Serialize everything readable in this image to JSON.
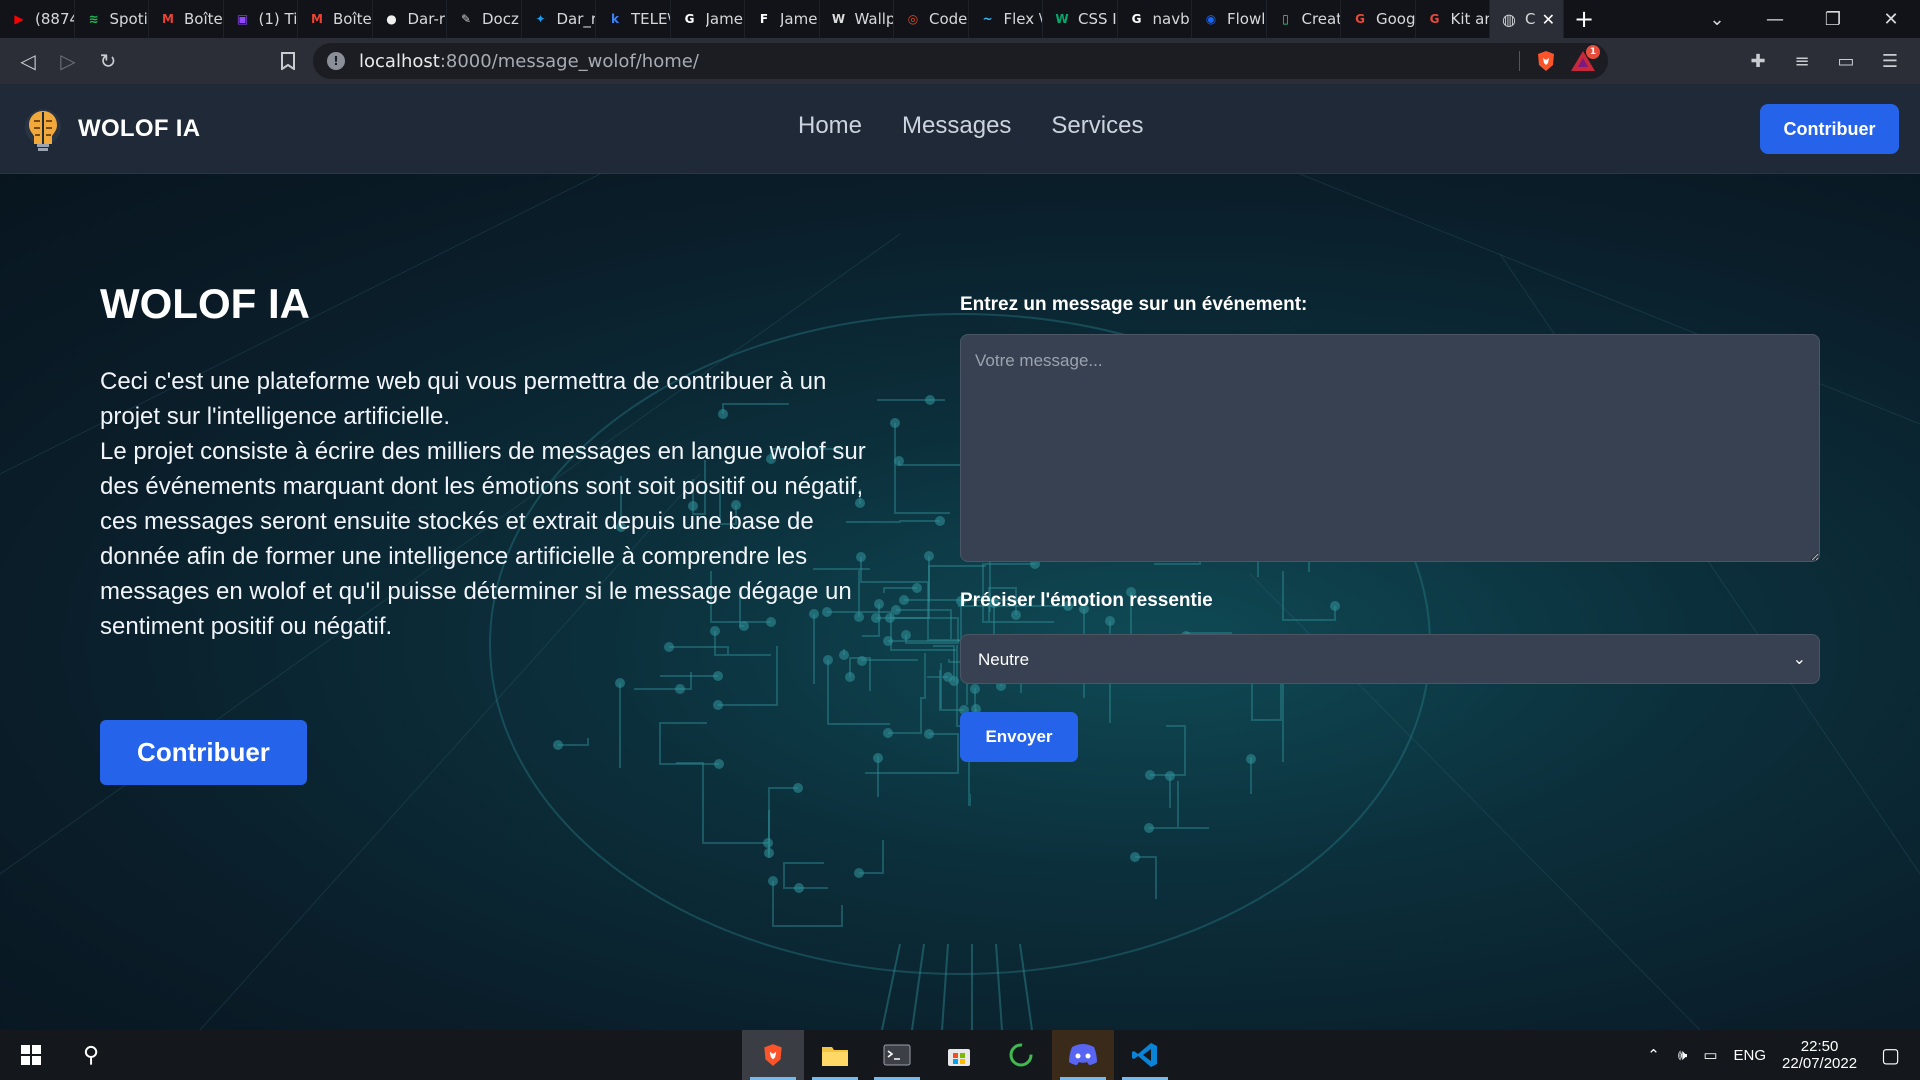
{
  "browser": {
    "tabs": [
      {
        "title": "(8874",
        "icon": "youtube-icon",
        "color": "#ff0000",
        "glyph": "▶"
      },
      {
        "title": "Spoti",
        "icon": "spotify-icon",
        "color": "#1db954",
        "glyph": "≋"
      },
      {
        "title": "Boîte",
        "icon": "gmail-icon",
        "color": "#ea4335",
        "glyph": "M"
      },
      {
        "title": "(1) Ti",
        "icon": "twitch-icon",
        "color": "#9146ff",
        "glyph": "▣"
      },
      {
        "title": "Boîte",
        "icon": "gmail-icon",
        "color": "#ea4335",
        "glyph": "M"
      },
      {
        "title": "Dar-r",
        "icon": "github-icon",
        "color": "#f0f0f0",
        "glyph": "●"
      },
      {
        "title": "Docz",
        "icon": "docz-icon",
        "color": "#cccccc",
        "glyph": "✎"
      },
      {
        "title": "Dar_r",
        "icon": "twitter-icon",
        "color": "#1d9bf0",
        "glyph": "✦"
      },
      {
        "title": "TELE\\",
        "icon": "k-icon",
        "color": "#3b82f6",
        "glyph": "k"
      },
      {
        "title": "Jame",
        "icon": "google-icon",
        "color": "#ffffff",
        "glyph": "G"
      },
      {
        "title": "Jame",
        "icon": "f-icon",
        "color": "#ffffff",
        "glyph": "F"
      },
      {
        "title": "Wallp",
        "icon": "w-icon",
        "color": "#dddddd",
        "glyph": "W"
      },
      {
        "title": "Code",
        "icon": "codepen-icon",
        "color": "#e44d26",
        "glyph": "◎"
      },
      {
        "title": "Flex \\",
        "icon": "tailwind-icon",
        "color": "#38bdf8",
        "glyph": "~"
      },
      {
        "title": "CSS I",
        "icon": "w3-icon",
        "color": "#04aa6d",
        "glyph": "W"
      },
      {
        "title": "navb",
        "icon": "google-icon",
        "color": "#ffffff",
        "glyph": "G"
      },
      {
        "title": "Flowl",
        "icon": "flowbite-icon",
        "color": "#1c64f2",
        "glyph": "◉"
      },
      {
        "title": "Creat",
        "icon": "android-icon",
        "color": "#3ddc84",
        "glyph": "▯"
      },
      {
        "title": "Goog",
        "icon": "grammarly-icon",
        "color": "#e64a3b",
        "glyph": "G"
      },
      {
        "title": "Kit ar",
        "icon": "grammarly-icon",
        "color": "#e64a3b",
        "glyph": "G"
      }
    ],
    "active_tab": {
      "title": "C",
      "icon": "globe-icon"
    },
    "url_host": "localhost",
    "url_path": ":8000/message_wolof/home/",
    "rewards_badge": "1"
  },
  "site": {
    "brand": "WOLOF IA",
    "nav": [
      "Home",
      "Messages",
      "Services"
    ],
    "nav_cta": "Contribuer",
    "hero": {
      "title": "WOLOF IA",
      "p1": "Ceci c'est une plateforme web qui vous permettra de contribuer à un projet sur l'intelligence artificielle.",
      "p2": "Le projet consiste à écrire des milliers de messages en langue wolof sur des événements marquant dont les émotions sont soit positif ou négatif, ces messages seront ensuite stockés et extrait depuis une base de donnée afin de former une intelligence artificielle à comprendre les messages en wolof et qu'il puisse déterminer si le message dégage un sentiment positif ou négatif.",
      "cta": "Contribuer"
    },
    "form": {
      "message_label": "Entrez un message sur un événement:",
      "message_placeholder": "Votre message...",
      "emotion_label": "Préciser l'émotion ressentie",
      "emotion_selected": "Neutre",
      "submit": "Envoyer"
    },
    "colors": {
      "accent": "#2563eb",
      "nav_bg": "#1f2937",
      "field_bg": "#374151"
    }
  },
  "taskbar": {
    "apps": [
      "brave-icon",
      "file-explorer-icon",
      "terminal-icon",
      "store-icon",
      "sync-icon",
      "discord-icon",
      "vscode-icon"
    ],
    "lang": "ENG",
    "time": "22:50",
    "date": "22/07/2022"
  }
}
